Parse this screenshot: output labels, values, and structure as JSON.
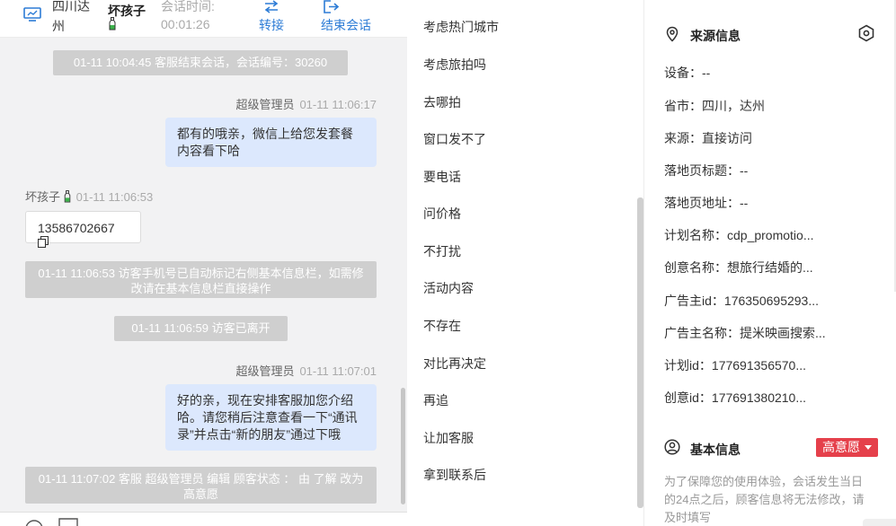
{
  "header": {
    "location": "四川达州",
    "visitor_name": "坏孩子",
    "time_label": "会话时间:",
    "time_value": "00:01:26",
    "transfer_label": "转接",
    "end_label": "结束会话",
    "accent_color": "#2d7cd6"
  },
  "messages": {
    "sys1": "01-11 10:04:45 客服结束会话，会话编号：30260",
    "agent1_sender": "超级管理员",
    "agent1_time": "01-11 11:06:17",
    "agent1_text": "都有的哦亲，微信上给您发套餐内容看下哈",
    "visitor_sender": "坏孩子",
    "visitor_time": "01-11 11:06:53",
    "visitor_phone": "13586702667",
    "sys2": "01-11 11:06:53 访客手机号已自动标记右侧基本信息栏，如需修改请在基本信息栏直接操作",
    "sys3": "01-11 11:06:59 访客已离开",
    "agent2_sender": "超级管理员",
    "agent2_time": "01-11 11:07:01",
    "agent2_text": "好的亲，现在安排客服加您介绍哈。请您稍后注意查看一下“通讯录”并点击“新的朋友”通过下哦",
    "sys4": "01-11 11:07:02 客服 超级管理员 编辑 顾客状态 ： 由 了解 改为 高意愿"
  },
  "quick_replies": [
    "考虑热门城市",
    "考虑旅拍吗",
    "去哪拍",
    "窗口发不了",
    "要电话",
    "问价格",
    "不打扰",
    "活动内容",
    "不存在",
    "对比再决定",
    "再追",
    "让加客服",
    "拿到联系后"
  ],
  "source_info": {
    "title": "来源信息",
    "rows": [
      {
        "label": "设备：",
        "value": "--"
      },
      {
        "label": "省市：",
        "value": "四川，达州"
      },
      {
        "label": "来源：",
        "value": "直接访问"
      },
      {
        "label": "落地页标题：",
        "value": "--"
      },
      {
        "label": "落地页地址：",
        "value": "--"
      },
      {
        "label": "计划名称：",
        "value": "cdp_promotio..."
      },
      {
        "label": "创意名称：",
        "value": "想旅行结婚的..."
      },
      {
        "label": "广告主id：",
        "value": "176350695293..."
      },
      {
        "label": "广告主名称：",
        "value": "提米映画搜索..."
      },
      {
        "label": "计划id：",
        "value": "177691356570..."
      },
      {
        "label": "创意id：",
        "value": "177691380210..."
      }
    ]
  },
  "basic_info": {
    "title": "基本信息",
    "status_badge": "高意愿",
    "badge_color": "#e5404b",
    "note": "为了保障您的使用体验，会话发生当日的24点之后，顾客信息将无法修改，请及时填写"
  }
}
